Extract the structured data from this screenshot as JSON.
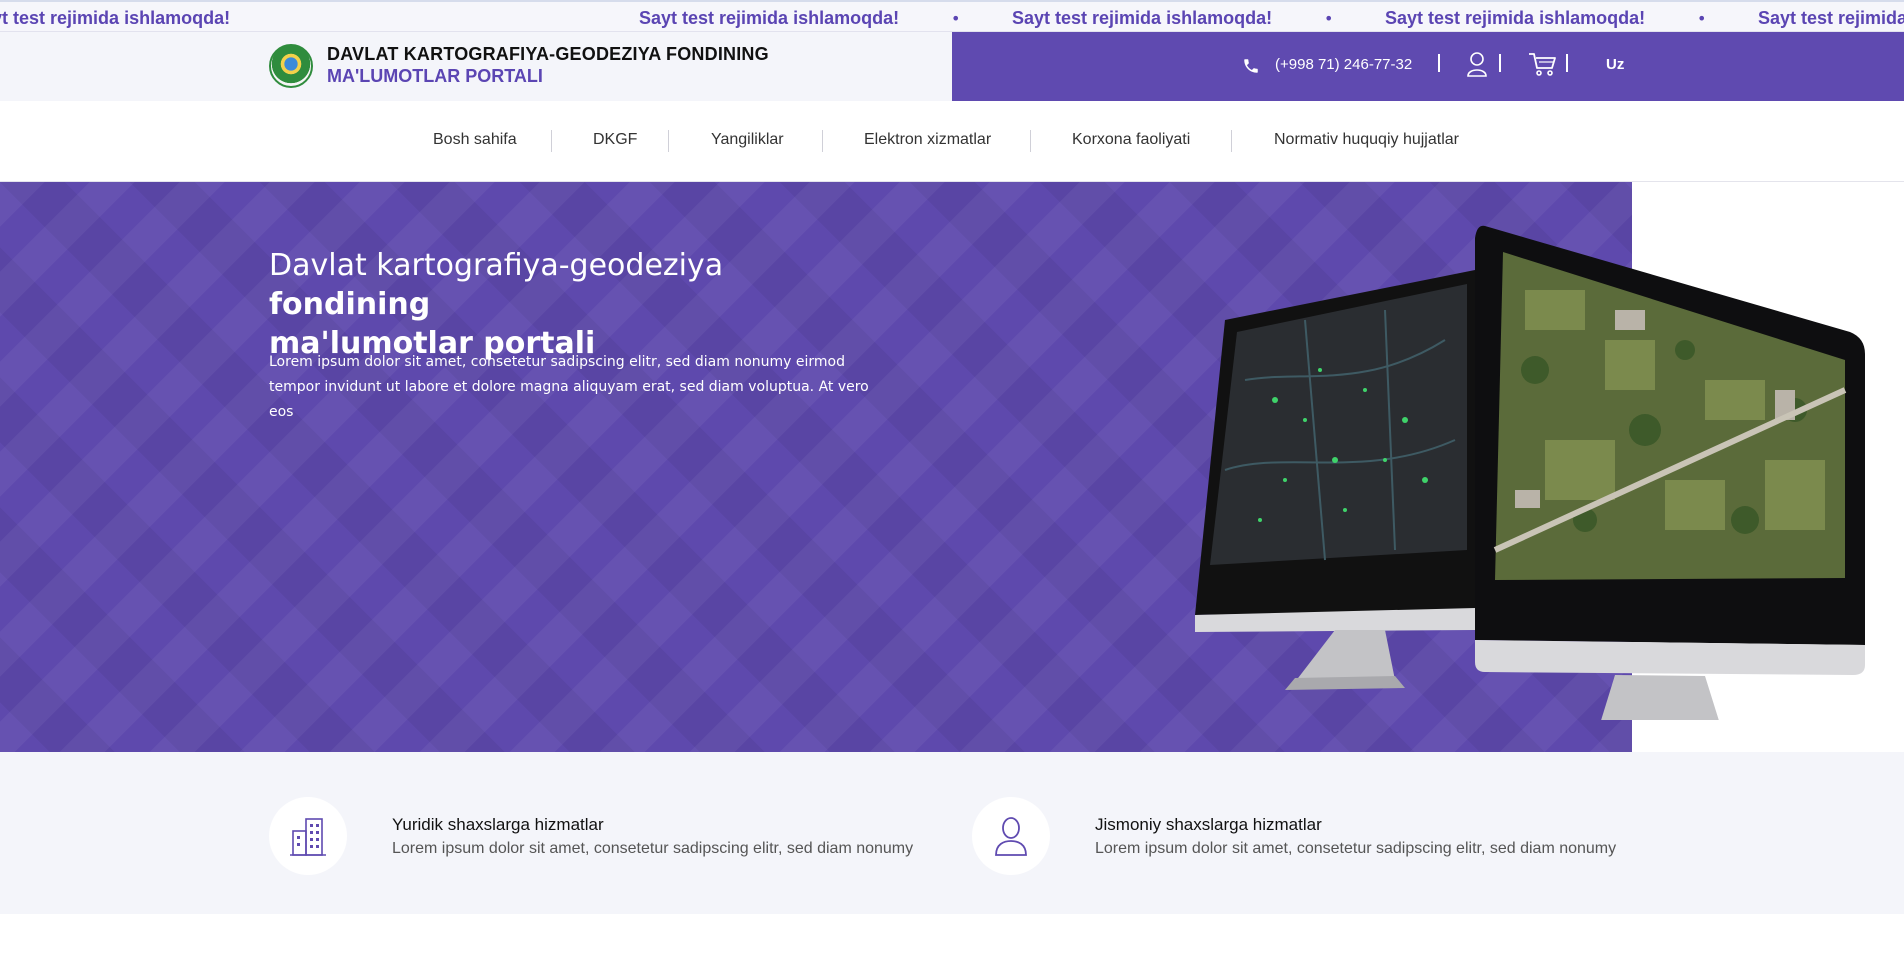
{
  "ticker": {
    "messages": [
      "Sayt test rejimida ishlamoqda!",
      "Sayt test rejimida ishlamoqda!",
      "Sayt test rejimida ishlamoqda!",
      "Sayt test rejimida ishlamoqda!",
      "Sayt test rejimida ishlamoqda!"
    ],
    "separator": "•"
  },
  "header": {
    "title_line1": "DAVLAT KARTOGRAFIYA-GEODEZIYA FONDINING",
    "title_line2": "MA'LUMOTLAR PORTALI",
    "phone": "(+998 71) 246-77-32",
    "language": "Uz"
  },
  "nav": {
    "items": [
      {
        "label": "Bosh sahifa"
      },
      {
        "label": "DKGF"
      },
      {
        "label": "Yangiliklar"
      },
      {
        "label": "Elektron xizmatlar"
      },
      {
        "label": "Korxona faoliyati"
      },
      {
        "label": "Normativ huquqiy hujjatlar"
      }
    ]
  },
  "hero": {
    "title_light": "Davlat kartografiya-geodeziya ",
    "title_bold_1": "fondining",
    "title_bold_2": "ma'lumotlar portali",
    "text": "Lorem ipsum dolor sit amet, consetetur sadipscing elitr, sed diam nonumy eirmod tempor invidunt ut labore et dolore magna aliquyam erat, sed diam voluptua. At vero eos"
  },
  "services": [
    {
      "title": "Yuridik shaxslarga hizmatlar",
      "desc": "Lorem ipsum dolor sit amet, consetetur sadipscing elitr, sed diam nonumy",
      "icon": "building-icon"
    },
    {
      "title": "Jismoniy shaxslarga hizmatlar",
      "desc": "Lorem ipsum dolor sit amet, consetetur sadipscing elitr, sed diam nonumy",
      "icon": "person-icon"
    }
  ],
  "colors": {
    "brand": "#5f4ab0",
    "ticker_text": "#5b45b3"
  }
}
